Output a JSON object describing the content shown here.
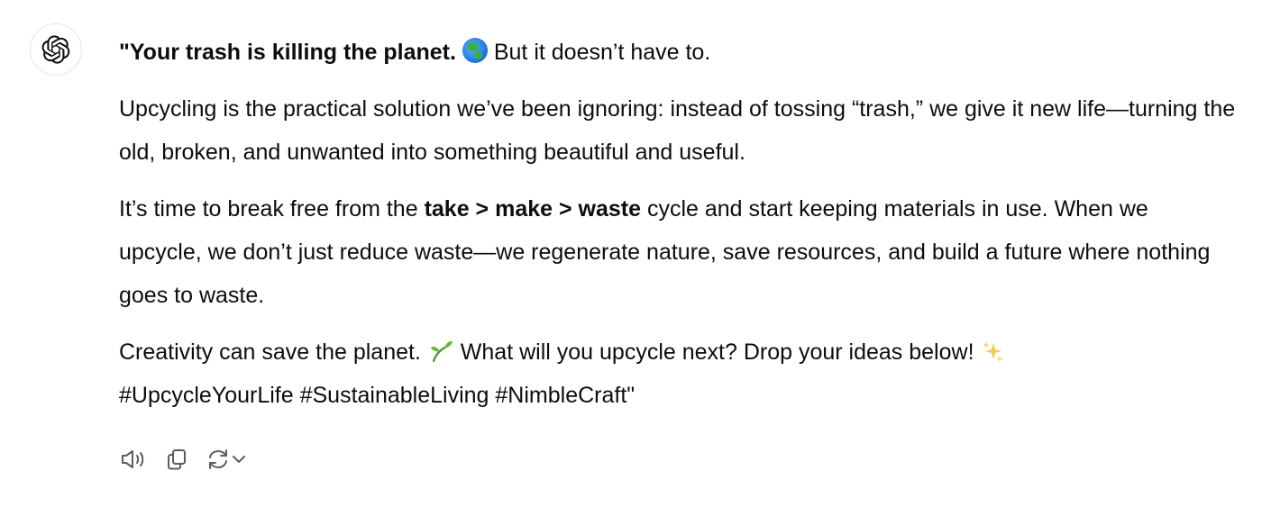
{
  "message": {
    "p1": {
      "bold": "\"Your trash is killing the planet.",
      "emoji": "🌍",
      "rest": " But it doesn’t have to."
    },
    "p2": "Upcycling is the practical solution we’ve been ignoring: instead of tossing “trash,” we give it new life—turning the old, broken, and unwanted into something beautiful and useful.",
    "p3": {
      "before": "It’s time to break free from the ",
      "bold": "take > make > waste",
      "after": " cycle and start keeping materials in use. When we upcycle, we don’t just reduce waste—we regenerate nature, save resources, and build a future where nothing goes to waste."
    },
    "p4": {
      "part1": "Creativity can save the planet. ",
      "emoji1": "🌱",
      "part2": " What will you upcycle next? Drop your ideas below! ",
      "emoji2": "✨",
      "hashtags": "#UpcycleYourLife #SustainableLiving #NimbleCraft\""
    }
  },
  "actions": {
    "read_aloud_icon": "speaker-icon",
    "copy_icon": "copy-icon",
    "regenerate_icon": "regenerate-icon",
    "dropdown_icon": "chevron-down-icon"
  },
  "colors": {
    "text": "#0d0d0d",
    "icon": "#5d5d5d",
    "avatar_border": "#e3e3e3"
  }
}
